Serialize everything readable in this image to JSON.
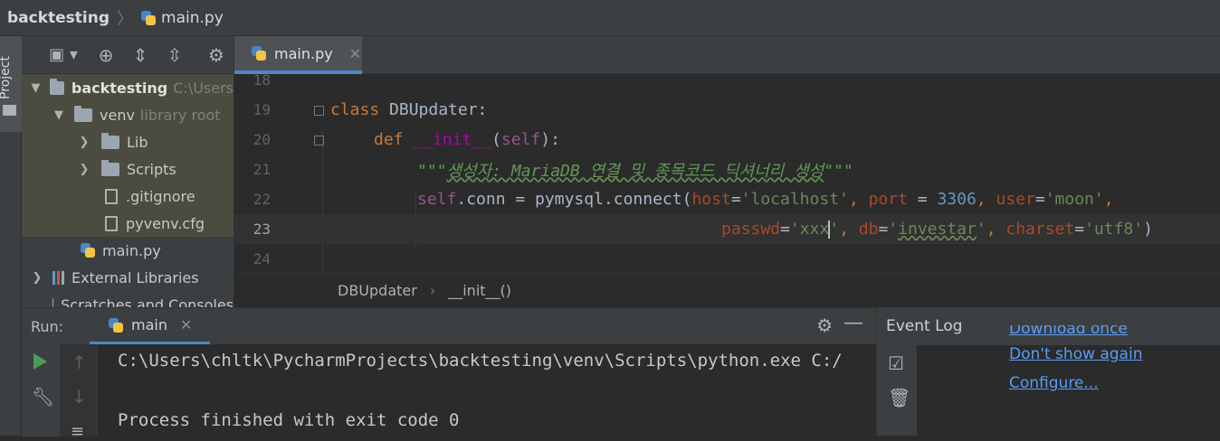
{
  "nav": {
    "project": "backtesting",
    "file": "main.py"
  },
  "sidebar": {
    "project_tab": "Project"
  },
  "project_panel": {
    "tree": [
      {
        "label": "backtesting",
        "hint": "C:\\Users"
      },
      {
        "label": "venv",
        "hint": "library root"
      },
      {
        "label": "Lib"
      },
      {
        "label": "Scripts"
      },
      {
        "label": ".gitignore"
      },
      {
        "label": "pyvenv.cfg"
      },
      {
        "label": "main.py"
      },
      {
        "label": "External Libraries"
      },
      {
        "label": "Scratches and Consoles"
      }
    ]
  },
  "editor": {
    "tab": "main.py",
    "lines": [
      "18",
      "19",
      "20",
      "21",
      "22",
      "23",
      "24"
    ],
    "code": {
      "l19_kw": "class",
      "l19_name": " DBUpdater:",
      "l20_kw": "def",
      "l20_fn": "__init__",
      "l20_open": "(",
      "l20_self": "self",
      "l20_close": "):",
      "l21_doc_open": "\"\"\"",
      "l21_doc": "생성자: MariaDB 연결 및 종목코드 딕셔너리 생성",
      "l21_doc_close": "\"\"\"",
      "l22_self": "self",
      "l22_a": ".conn = pymysql.connect(",
      "l22_host": "host",
      "l22_eq1": "=",
      "l22_hostv": "'localhost'",
      "l22_c1": ", ",
      "l22_port": "port",
      "l22_eq2": " = ",
      "l22_portv": "3306",
      "l22_c2": ", ",
      "l22_user": "user",
      "l22_eq3": "=",
      "l22_userv": "'moon'",
      "l22_c3": ",",
      "l23_pw": "passwd",
      "l23_eq1": "=",
      "l23_pwv1": "'xxx",
      "l23_pwv2": "'",
      "l23_c1": ", ",
      "l23_db": "db",
      "l23_eq2": "=",
      "l23_dbq1": "'",
      "l23_dbv": "investar",
      "l23_dbq2": "'",
      "l23_c2": ", ",
      "l23_cs": "charset",
      "l23_eq3": "=",
      "l23_csv": "'utf8'",
      "l23_end": ")"
    },
    "breadcrumbs": [
      "DBUpdater",
      "__init__()"
    ]
  },
  "run": {
    "label": "Run:",
    "tab": "main",
    "console": [
      "C:\\Users\\chltk\\PycharmProjects\\backtesting\\venv\\Scripts\\python.exe C:/",
      "",
      "Process finished with exit code 0"
    ]
  },
  "event_log": {
    "title": "Event Log",
    "links": [
      "Download once",
      "Don't show again",
      "Configure..."
    ]
  },
  "colors": {
    "accent": "#4a88c7",
    "keyword": "#cc7832",
    "string": "#6a8759",
    "number": "#6897bb",
    "link": "#589df6"
  }
}
